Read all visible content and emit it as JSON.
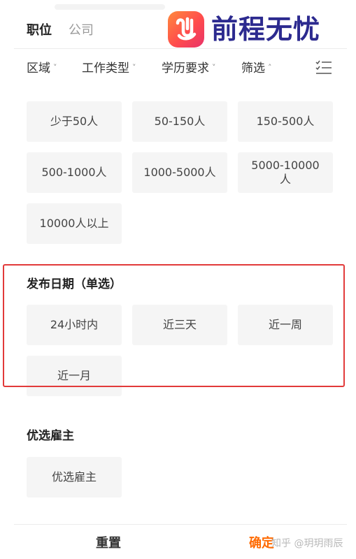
{
  "tabs": {
    "job": "职位",
    "company": "公司"
  },
  "logo": {
    "text": "前程无忧",
    "mark_icon": "51job-hand-icon",
    "colors": [
      "#ff8a3d",
      "#ff4c4c",
      "#2c2a8f"
    ]
  },
  "filters": [
    {
      "label": "区域",
      "caret": "˅"
    },
    {
      "label": "工作类型",
      "caret": "˅"
    },
    {
      "label": "学历要求",
      "caret": "˅"
    },
    {
      "label": "筛选",
      "caret": "˄"
    }
  ],
  "list_icon": "list-checks-icon",
  "company_size": [
    "少于50人",
    "50-150人",
    "150-500人",
    "500-1000人",
    "1000-5000人",
    "5000-10000人",
    "10000人以上"
  ],
  "publish_date": {
    "title": "发布日期（单选）",
    "options": [
      "24小时内",
      "近三天",
      "近一周",
      "近一月"
    ]
  },
  "employer": {
    "title": "优选雇主",
    "options": [
      "优选雇主"
    ]
  },
  "actions": {
    "reset": "重置",
    "confirm": "确定"
  },
  "watermark": "知乎 @玥玥雨辰",
  "accent_color": "#ff6a00",
  "highlight_color": "#e23a3a"
}
